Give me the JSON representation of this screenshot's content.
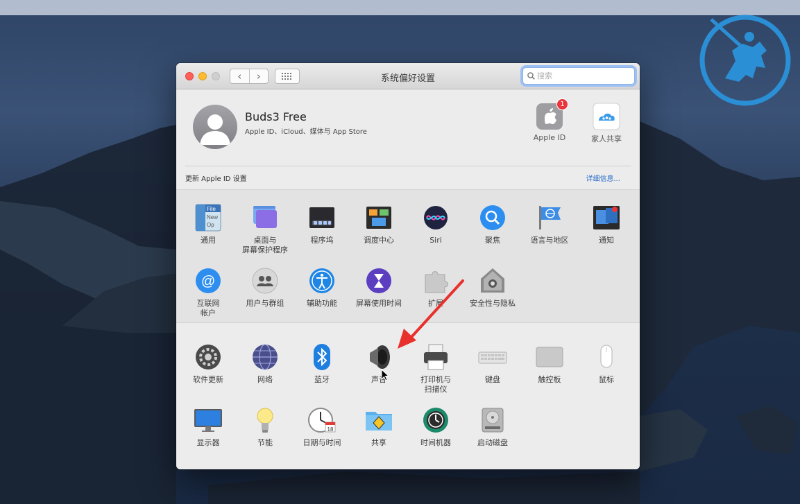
{
  "window": {
    "title": "系统偏好设置"
  },
  "search": {
    "placeholder": "搜索"
  },
  "nav": {
    "back": "‹",
    "forward": "›"
  },
  "account": {
    "name": "Buds3 Free",
    "subtitle": "Apple ID、iCloud、媒体与 App Store",
    "apple_id_label": "Apple ID",
    "apple_id_badge": "1",
    "family_label": "家人共享",
    "update_text": "更新 Apple ID 设置",
    "details_link": "详细信息..."
  },
  "panes_row1": [
    {
      "label": "通用",
      "icon": "general-icon"
    },
    {
      "label": "桌面与\n屏幕保护程序",
      "icon": "desktop-screensaver-icon"
    },
    {
      "label": "程序坞",
      "icon": "dock-icon"
    },
    {
      "label": "调度中心",
      "icon": "mission-control-icon"
    },
    {
      "label": "Siri",
      "icon": "siri-icon"
    },
    {
      "label": "聚焦",
      "icon": "spotlight-icon"
    },
    {
      "label": "语言与地区",
      "icon": "language-region-icon"
    },
    {
      "label": "通知",
      "icon": "notifications-icon"
    }
  ],
  "panes_row2": [
    {
      "label": "互联网\n帐户",
      "icon": "internet-accounts-icon"
    },
    {
      "label": "用户与群组",
      "icon": "users-groups-icon"
    },
    {
      "label": "辅助功能",
      "icon": "accessibility-icon"
    },
    {
      "label": "屏幕使用时间",
      "icon": "screen-time-icon"
    },
    {
      "label": "扩展",
      "icon": "extensions-icon"
    },
    {
      "label": "安全性与隐私",
      "icon": "security-privacy-icon"
    }
  ],
  "panes_row3": [
    {
      "label": "软件更新",
      "icon": "software-update-icon"
    },
    {
      "label": "网络",
      "icon": "network-icon"
    },
    {
      "label": "蓝牙",
      "icon": "bluetooth-icon"
    },
    {
      "label": "声音",
      "icon": "sound-icon"
    },
    {
      "label": "打印机与\n扫描仪",
      "icon": "printers-scanners-icon"
    },
    {
      "label": "键盘",
      "icon": "keyboard-icon"
    },
    {
      "label": "触控板",
      "icon": "trackpad-icon"
    },
    {
      "label": "鼠标",
      "icon": "mouse-icon"
    }
  ],
  "panes_row4": [
    {
      "label": "显示器",
      "icon": "displays-icon"
    },
    {
      "label": "节能",
      "icon": "energy-saver-icon"
    },
    {
      "label": "日期与时间",
      "icon": "date-time-icon"
    },
    {
      "label": "共享",
      "icon": "sharing-icon"
    },
    {
      "label": "时间机器",
      "icon": "time-machine-icon"
    },
    {
      "label": "启动磁盘",
      "icon": "startup-disk-icon"
    }
  ],
  "colors": {
    "accent": "#2a6ec9",
    "annotation_arrow": "#e8302c",
    "badge": "#e9353b"
  }
}
